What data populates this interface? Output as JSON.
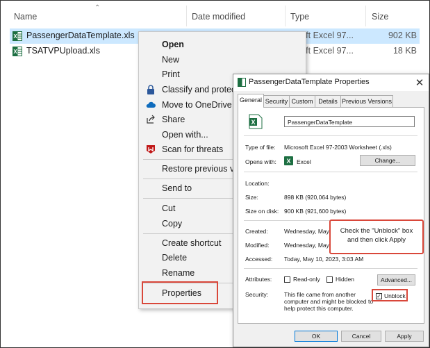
{
  "explorer": {
    "columns": [
      "Name",
      "Date modified",
      "Type",
      "Size"
    ],
    "files": [
      {
        "name": "PassengerDataTemplate.xls",
        "type": "osoft Excel 97...",
        "size": "902 KB",
        "selected": true
      },
      {
        "name": "TSATVPUpload.xls",
        "type": "osoft Excel 97...",
        "size": "18 KB",
        "selected": false
      }
    ]
  },
  "context_menu": {
    "open": "Open",
    "new": "New",
    "print": "Print",
    "classify": "Classify and protect",
    "move_onedrive": "Move to OneDrive",
    "share": "Share",
    "open_with": "Open with...",
    "scan": "Scan for threats",
    "restore": "Restore previous versions",
    "send_to": "Send to",
    "cut": "Cut",
    "copy": "Copy",
    "create_shortcut": "Create shortcut",
    "delete": "Delete",
    "rename": "Rename",
    "properties": "Properties"
  },
  "dialog": {
    "title": "PassengerDataTemplate Properties",
    "tabs": [
      "General",
      "Security",
      "Custom",
      "Details",
      "Previous Versions"
    ],
    "file_name": "PassengerDataTemplate",
    "type_label": "Type of file:",
    "type_value": "Microsoft Excel 97-2003 Worksheet (.xls)",
    "opens_label": "Opens with:",
    "opens_value": "Excel",
    "change_button": "Change...",
    "location_label": "Location:",
    "size_label": "Size:",
    "size_value": "898 KB (920,064 bytes)",
    "size_disk_label": "Size on disk:",
    "size_disk_value": "900 KB (921,600 bytes)",
    "created_label": "Created:",
    "created_value": "Wednesday, May",
    "modified_label": "Modified:",
    "modified_value": "Wednesday, May",
    "accessed_label": "Accessed:",
    "accessed_value": "Today, May 10, 2023, 3:03 AM",
    "attributes_label": "Attributes:",
    "readonly_label": "Read-only",
    "hidden_label": "Hidden",
    "advanced_button": "Advanced...",
    "security_label": "Security:",
    "security_text": [
      "This file came from another",
      "computer and might be blocked to",
      "help protect this computer."
    ],
    "unblock_label": "Unblock",
    "ok_button": "OK",
    "cancel_button": "Cancel",
    "apply_button": "Apply"
  },
  "callout": {
    "line1": "Check the \"Unblock\" box",
    "line2": "and then click Apply"
  },
  "colors": {
    "selection": "#cce8ff",
    "highlight_red": "#d9473a",
    "excel_green": "#1d6f42"
  }
}
